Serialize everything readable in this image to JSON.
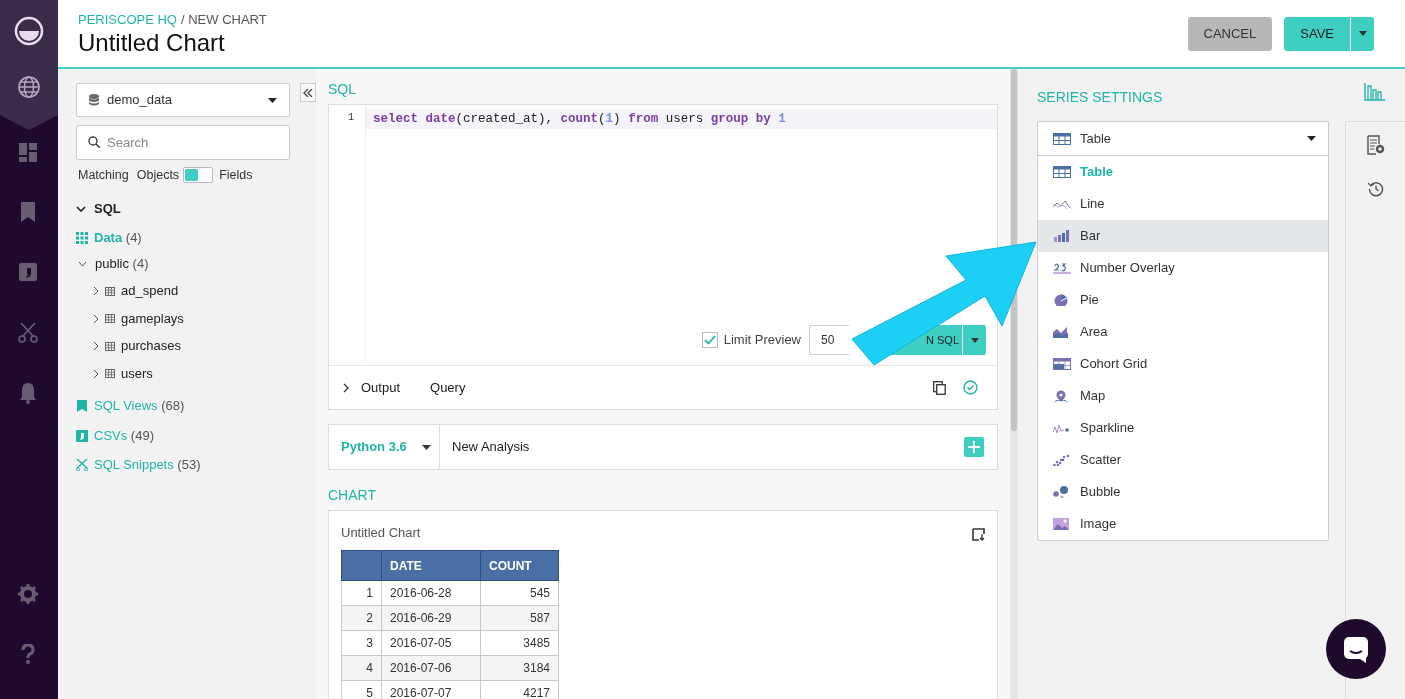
{
  "nav": [
    {
      "kind": "globe",
      "selected": true
    },
    {
      "kind": "dashboards",
      "selected": false
    },
    {
      "kind": "bookmark",
      "selected": false
    },
    {
      "kind": "comma",
      "selected": false
    },
    {
      "kind": "scissors",
      "selected": false
    },
    {
      "kind": "bell",
      "selected": false
    }
  ],
  "nav_bottom": [
    {
      "kind": "gear",
      "selected": false
    },
    {
      "kind": "help",
      "selected": false
    }
  ],
  "breadcrumb": [
    {
      "text": "PERISCOPE HQ",
      "kind": "link"
    },
    {
      "text": "/ NEW CHART",
      "kind": "current"
    }
  ],
  "title": "Untitled Chart",
  "header_buttons": {
    "cancel": "CANCEL",
    "save": "SAVE"
  },
  "schema": {
    "database": "demo_data",
    "search_placeholder": "Search",
    "matching_label": "Matching",
    "toggle_left": "Objects",
    "toggle_right": "Fields",
    "on": false,
    "section": {
      "label": "SQL",
      "expanded": true
    },
    "items": [
      {
        "kind": "data",
        "label": "Data",
        "count": "(4)",
        "children": [
          {
            "label": "public",
            "count": "(4)",
            "expanded": true,
            "children": [
              {
                "label": "ad_spend",
                "expanded": false
              },
              {
                "label": "gameplays",
                "expanded": false
              },
              {
                "label": "purchases",
                "expanded": false
              },
              {
                "label": "users",
                "expanded": false
              }
            ]
          }
        ]
      },
      {
        "kind": "views",
        "label": "SQL Views",
        "count": "(68)"
      },
      {
        "kind": "csvs",
        "label": "CSVs",
        "count": "(49)"
      },
      {
        "kind": "snippets",
        "label": "SQL Snippets",
        "count": "(53)"
      }
    ]
  },
  "sql": {
    "label": "SQL",
    "line_numbers": [
      "1"
    ],
    "tokens": [
      {
        "text": "select",
        "kind": "keyword"
      },
      {
        "text": " date",
        "kind": "keyword"
      },
      {
        "text": "(created_at), ",
        "kind": "plain"
      },
      {
        "text": "count",
        "kind": "keyword"
      },
      {
        "text": "(",
        "kind": "plain"
      },
      {
        "text": "1",
        "kind": "number"
      },
      {
        "text": ") ",
        "kind": "plain"
      },
      {
        "text": "from",
        "kind": "keyword"
      },
      {
        "text": " users ",
        "kind": "plain"
      },
      {
        "text": "group by",
        "kind": "keyword"
      },
      {
        "text": " 1",
        "kind": "number"
      }
    ],
    "limit_preview": {
      "label": "Limit Preview",
      "checked": true
    },
    "limit_value": "50",
    "run_button": "N SQL",
    "output_tabs": [
      {
        "label": "Output",
        "expanded": false
      },
      {
        "label": "Query"
      }
    ]
  },
  "analysis": {
    "language": "Python 3.6",
    "name": "New Analysis"
  },
  "chart": {
    "label": "CHART",
    "title": "Untitled Chart",
    "columns": [
      "DATE",
      "COUNT"
    ],
    "rows": [
      {
        "index": "1",
        "date": "2016-06-28",
        "count": "545"
      },
      {
        "index": "2",
        "date": "2016-06-29",
        "count": "587"
      },
      {
        "index": "3",
        "date": "2016-07-05",
        "count": "3485"
      },
      {
        "index": "4",
        "date": "2016-07-06",
        "count": "3184"
      },
      {
        "index": "5",
        "date": "2016-07-07",
        "count": "4217"
      }
    ]
  },
  "series_settings": {
    "title": "SERIES SETTINGS",
    "value": "Table",
    "options": [
      {
        "kind": "table",
        "label": "Table",
        "selected": true,
        "hovered": false
      },
      {
        "kind": "line",
        "label": "Line",
        "selected": false,
        "hovered": false
      },
      {
        "kind": "bar",
        "label": "Bar",
        "selected": false,
        "hovered": true
      },
      {
        "kind": "number",
        "label": "Number Overlay",
        "selected": false,
        "hovered": false
      },
      {
        "kind": "pie",
        "label": "Pie",
        "selected": false,
        "hovered": false
      },
      {
        "kind": "area",
        "label": "Area",
        "selected": false,
        "hovered": false
      },
      {
        "kind": "cohort",
        "label": "Cohort Grid",
        "selected": false,
        "hovered": false
      },
      {
        "kind": "map",
        "label": "Map",
        "selected": false,
        "hovered": false
      },
      {
        "kind": "sparkline",
        "label": "Sparkline",
        "selected": false,
        "hovered": false
      },
      {
        "kind": "scatter",
        "label": "Scatter",
        "selected": false,
        "hovered": false
      },
      {
        "kind": "bubble",
        "label": "Bubble",
        "selected": false,
        "hovered": false
      },
      {
        "kind": "image",
        "label": "Image",
        "selected": false,
        "hovered": false
      }
    ]
  },
  "side_tabs": [
    {
      "kind": "chart",
      "selected": true
    },
    {
      "kind": "settings",
      "selected": false
    },
    {
      "kind": "history",
      "selected": false
    }
  ]
}
